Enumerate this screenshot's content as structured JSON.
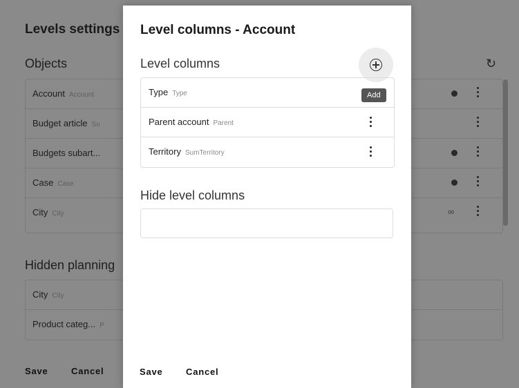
{
  "background": {
    "title": "Levels settings",
    "objects_label": "Objects",
    "objects": [
      {
        "name": "Account",
        "sub": "Account",
        "marker": "dot"
      },
      {
        "name": "Budget article",
        "sub": "Su",
        "marker": ""
      },
      {
        "name": "Budgets subart...",
        "sub": "",
        "marker": "dot"
      },
      {
        "name": "Case",
        "sub": "Case",
        "marker": "dot"
      },
      {
        "name": "City",
        "sub": "City",
        "marker": "link"
      }
    ],
    "hidden_label": "Hidden planning",
    "hidden": [
      {
        "name": "City",
        "sub": "City"
      },
      {
        "name": "Product categ...",
        "sub": "P"
      }
    ],
    "save": "Save",
    "cancel": "Cancel"
  },
  "modal": {
    "title": "Level columns - Account",
    "level_columns_label": "Level columns",
    "add_tooltip": "Add",
    "columns": [
      {
        "name": "Type",
        "sub": "Type"
      },
      {
        "name": "Parent account",
        "sub": "Parent"
      },
      {
        "name": "Territory",
        "sub": "SumTerritory"
      }
    ],
    "hide_label": "Hide level columns",
    "hide_value": "",
    "save": "Save",
    "cancel": "Cancel"
  },
  "icons": {
    "add": "add-circle-icon",
    "more": "more-vertical-icon",
    "refresh": "refresh-icon",
    "link": "link-icon",
    "dot": "status-dot-icon"
  }
}
